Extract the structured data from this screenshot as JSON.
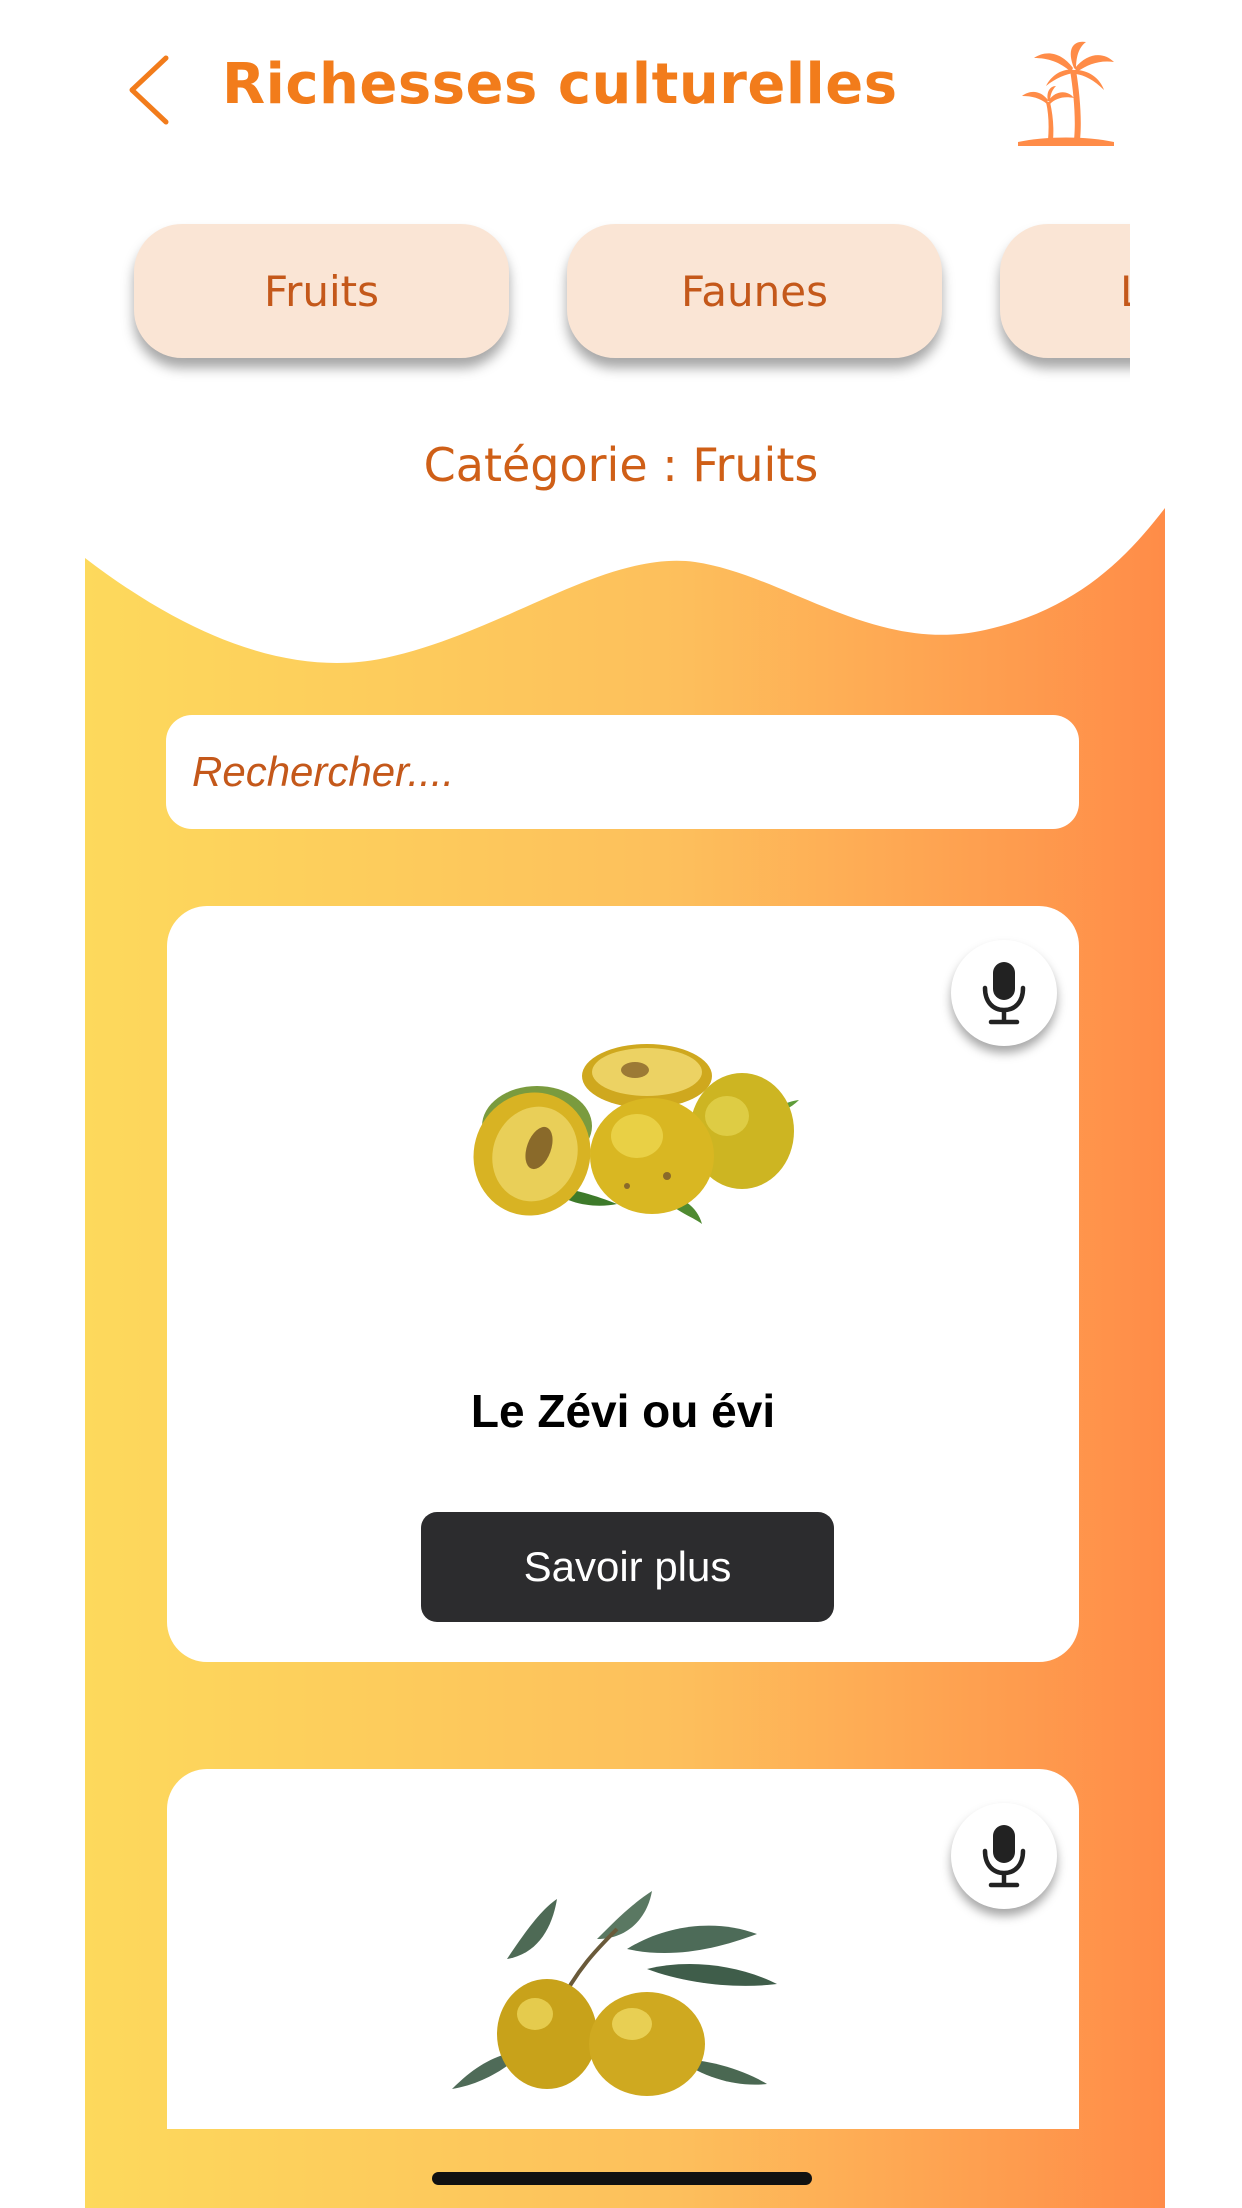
{
  "header": {
    "title": "Richesses culturelles",
    "back_icon": "chevron-left-icon",
    "logo_icon": "palm-tree-icon"
  },
  "categories": [
    {
      "label": "Fruits"
    },
    {
      "label": "Faunes"
    },
    {
      "label": "L"
    }
  ],
  "category_label": "Catégorie : Fruits",
  "search": {
    "placeholder": "Rechercher...."
  },
  "cards": [
    {
      "title": "Le Zévi ou évi",
      "button_label": "Savoir plus",
      "mic_icon": "microphone-icon",
      "image": "zevi-fruit-image"
    },
    {
      "title": "",
      "mic_icon": "microphone-icon",
      "image": "olive-fruit-image"
    }
  ],
  "colors": {
    "accent": "#f27c1b",
    "pill_bg": "#fae5d5",
    "pill_text": "#c4581a",
    "gradient_start": "#fdd95c",
    "gradient_end": "#ff8c48",
    "button_bg": "#2c2c2e"
  }
}
